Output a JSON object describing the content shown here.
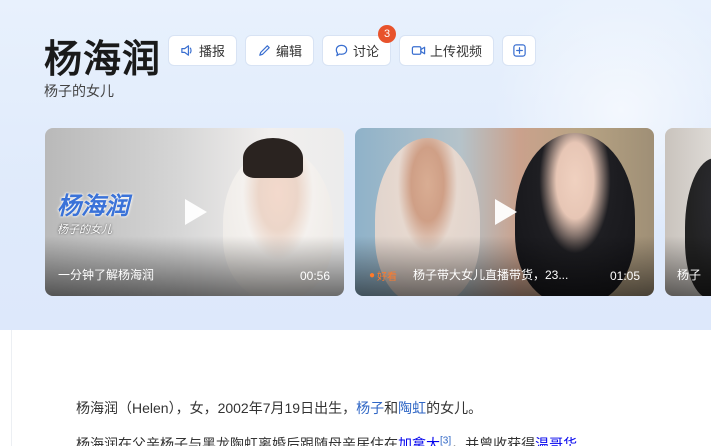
{
  "header": {
    "title": "杨海润",
    "subtitle": "杨子的女儿"
  },
  "actions": [
    {
      "label": "播报",
      "icon": "speaker-icon"
    },
    {
      "label": "编辑",
      "icon": "pencil-icon"
    },
    {
      "label": "讨论",
      "icon": "chat-bubble-icon",
      "badge": "3"
    },
    {
      "label": "上传视频",
      "icon": "video-camera-icon"
    },
    {
      "label": "",
      "icon": "plus-square-icon"
    }
  ],
  "videos": [
    {
      "title": "一分钟了解杨海润",
      "duration": "00:56",
      "overlay_name": "杨海润",
      "overlay_sub": "杨子的女儿"
    },
    {
      "title": "杨子带大女儿直播带货，23...",
      "duration": "01:05",
      "source": "好看"
    },
    {
      "title": "杨子"
    }
  ],
  "article": {
    "p1_a": "杨海润（Helen），女，2002年7月19日出生，",
    "p1_link1": "杨子",
    "p1_b": "和",
    "p1_link2": "陶虹",
    "p1_c": "的女儿。",
    "p2_a": "杨海润在父亲杨子与黑龙陶虹离婚后跟随母亲居住在",
    "p2_link1": "加拿大",
    "p2_ref": "[3]",
    "p2_b": "，并曾收获得",
    "p2_link2": "温哥华"
  },
  "colors": {
    "accent": "#2f66c5",
    "badge": "#e8532c",
    "hero_bg": "#e3edfc"
  }
}
